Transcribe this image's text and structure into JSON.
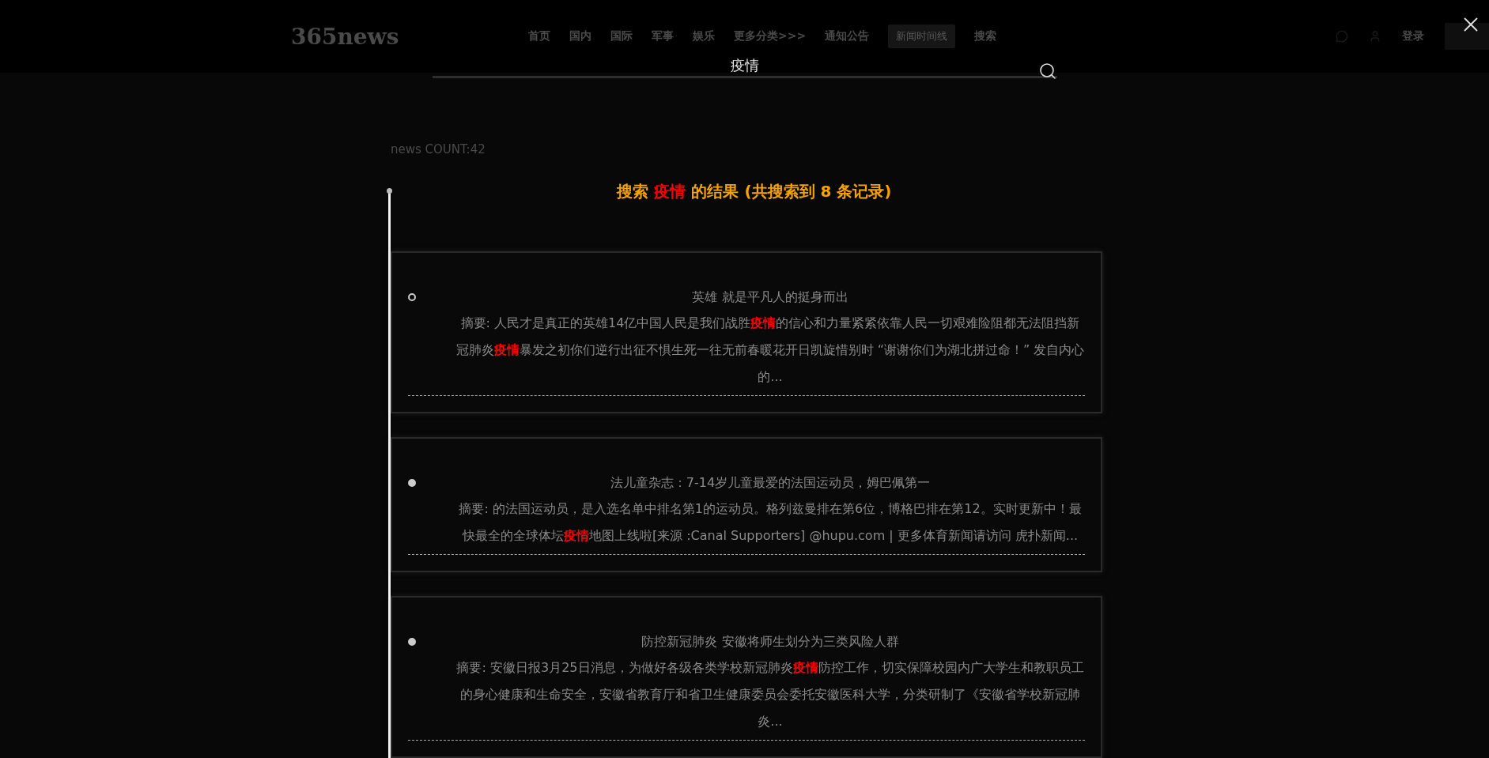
{
  "header": {
    "logo": "365news",
    "nav": [
      "首页",
      "国内",
      "国际",
      "军事",
      "娱乐",
      "更多分类>>>",
      "通知公告"
    ],
    "timeline_button": "新闻时间线",
    "search_link": "搜索",
    "login": "登录"
  },
  "page": {
    "count": "news COUNT:42"
  },
  "search": {
    "value": "疫情"
  },
  "results": {
    "heading": "搜索 **疫情** 的结果 (共搜索到 8 条记录)",
    "items": [
      {
        "title": "英雄 就是平凡人的挺身而出",
        "summary": "摘要: 人民才是真正的英雄14亿中国人民是我们战胜**疫情**的信心和力量紧紧依靠人民一切艰难险阻都无法阻挡新冠肺炎**疫情**暴发之初你们逆行出征不惧生死一往无前春暖花开日凯旋惜别时 “谢谢你们为湖北拼过命！” 发自内心的...",
        "selected": true
      },
      {
        "title": "法儿童杂志：7-14岁儿童最爱的法国运动员，姆巴佩第一",
        "summary": "摘要: 的法国运动员，是入选名单中排名第1的运动员。格列兹曼排在第6位，博格巴排在第12。实时更新中！最快最全的全球体坛**疫情**地图上线啦[来源 :Canal Supporters] @hupu.com | 更多体育新闻请访问 虎扑新闻...",
        "selected": false
      },
      {
        "title": "防控新冠肺炎 安徽将师生划分为三类风险人群",
        "summary": "摘要: 安徽日报3月25日消息，为做好各级各类学校新冠肺炎**疫情**防控工作，切实保障校园内广大学生和教职员工的身心健康和生命安全，安徽省教育厅和省卫生健康委员会委托安徽医科大学，分类研制了《安徽省学校新冠肺炎...",
        "selected": false
      }
    ]
  }
}
